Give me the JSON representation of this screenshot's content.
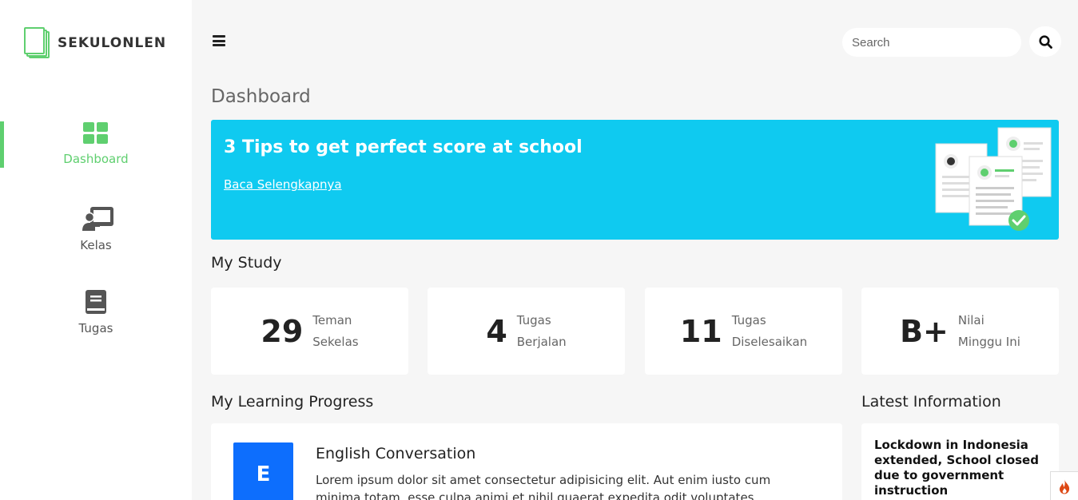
{
  "brand": {
    "name": "SEKULONLEN",
    "accent_color": "#5fcf6f"
  },
  "sidebar": {
    "items": [
      {
        "label": "Dashboard",
        "icon": "grid-icon",
        "active": true
      },
      {
        "label": "Kelas",
        "icon": "chalkboard-teacher-icon",
        "active": false
      },
      {
        "label": "Tugas",
        "icon": "book-icon",
        "active": false
      }
    ]
  },
  "topbar": {
    "search_placeholder": "Search",
    "menu_icon": "hamburger-icon",
    "search_icon": "search-icon"
  },
  "page": {
    "title": "Dashboard"
  },
  "banner": {
    "title": "3 Tips to get perfect score at school",
    "link": "Baca Selengkapnya",
    "color": "#0fcaf0"
  },
  "my_study": {
    "title": "My Study",
    "stats": [
      {
        "value": "29",
        "label_1": "Teman",
        "label_2": "Sekelas"
      },
      {
        "value": "4",
        "label_1": "Tugas",
        "label_2": "Berjalan"
      },
      {
        "value": "11",
        "label_1": "Tugas",
        "label_2": "Diselesaikan"
      },
      {
        "value": "B+",
        "label_1": "Nilai",
        "label_2": "Minggu Ini"
      }
    ]
  },
  "progress": {
    "title": "My Learning Progress",
    "course": {
      "badge": "E",
      "badge_color": "#0d6efd",
      "title": "English Conversation",
      "description": "Lorem ipsum dolor sit amet consectetur adipisicing elit. Aut enim iusto cum minima totam, esse culpa animi et nihil quaerat expedita odit voluptates earum"
    }
  },
  "info": {
    "title": "Latest Information",
    "headline": "Lockdown in Indonesia extended, School closed due to government instruction"
  }
}
